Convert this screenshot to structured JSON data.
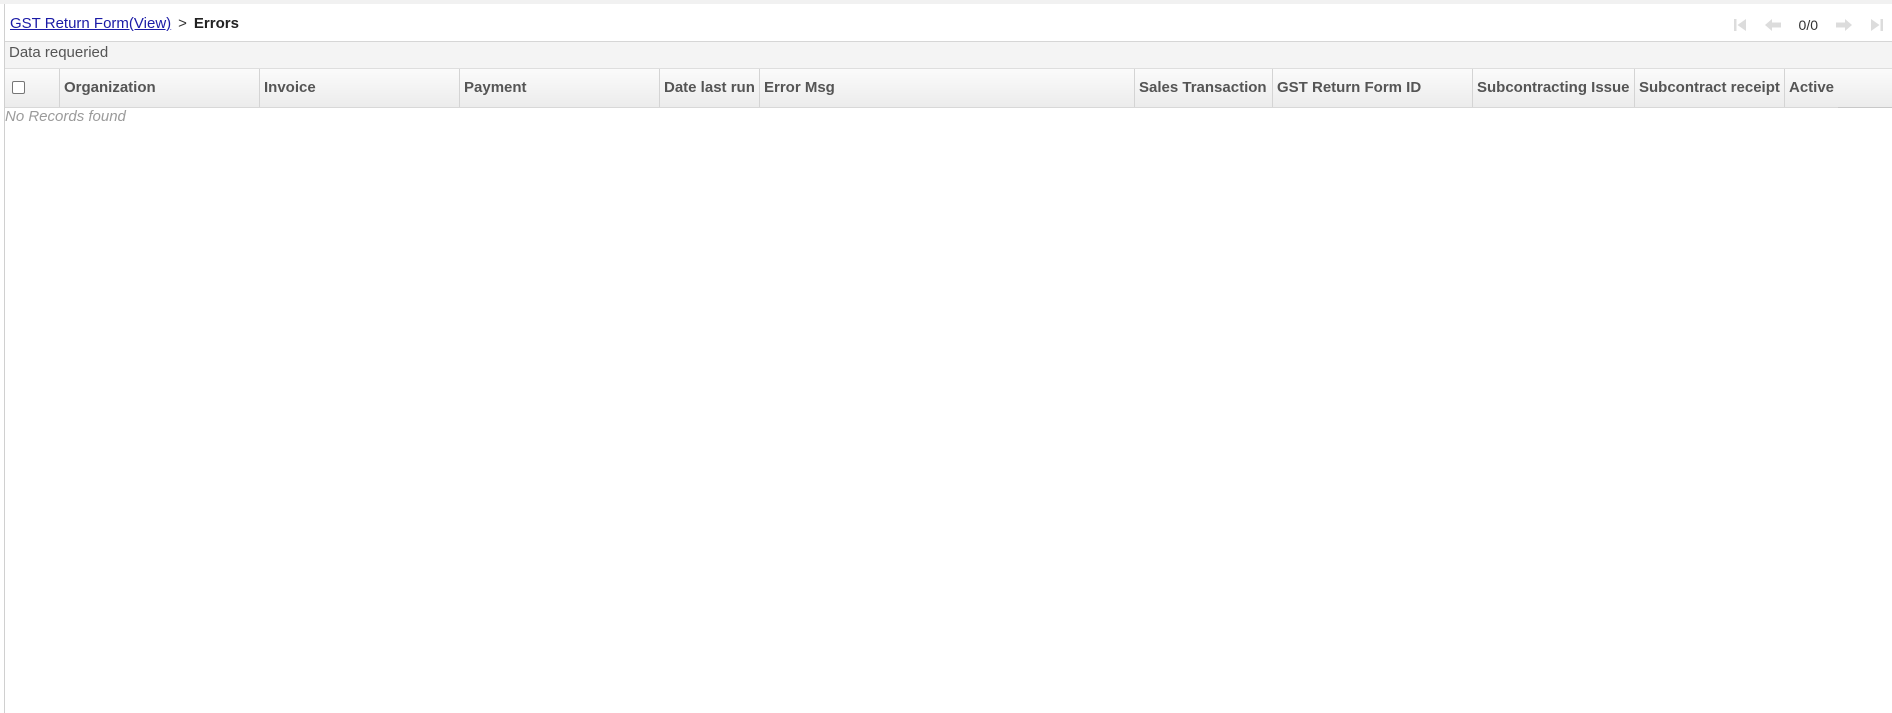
{
  "breadcrumb": {
    "parent_label": "GST Return Form(View)",
    "separator": ">",
    "current_label": "Errors"
  },
  "pager": {
    "count_text": "0/0",
    "buttons": [
      "first-page-icon",
      "previous-page-icon",
      "next-page-icon",
      "last-page-icon"
    ],
    "disabled_color": "#d9d9d9"
  },
  "status": {
    "message": "Data requeried"
  },
  "grid": {
    "columns": [
      "Organization",
      "Invoice",
      "Payment",
      "Date last run",
      "Error Msg",
      "Sales Transaction",
      "GST Return Form ID",
      "Subcontracting Issue",
      "Subcontract receipt",
      "Active"
    ],
    "rows": [],
    "empty_message": "No Records found"
  },
  "colors": {
    "link": "#1a1aa6",
    "header_text": "#555555",
    "empty_text": "#9b9b9b"
  }
}
